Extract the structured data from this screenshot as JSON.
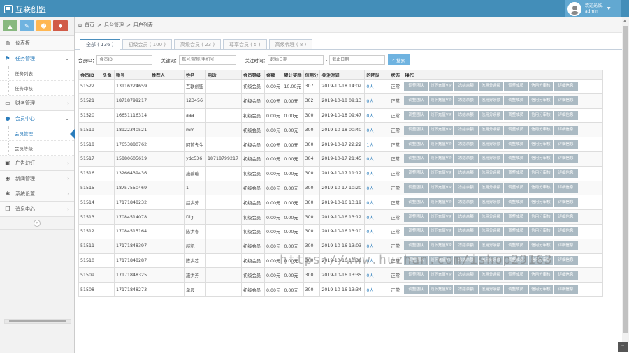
{
  "app": {
    "brand": "互联创盟"
  },
  "user": {
    "greeting": "欢迎光临,",
    "name": "admin"
  },
  "shortcuts": [
    {
      "icon": "chart-icon",
      "glyph": "▲",
      "color": "#87b87f"
    },
    {
      "icon": "pencil-icon",
      "glyph": "✎",
      "color": "#6fb3e0"
    },
    {
      "icon": "users-icon",
      "glyph": "☻",
      "color": "#ffb752"
    },
    {
      "icon": "bell-icon",
      "glyph": "♦",
      "color": "#d15b47"
    }
  ],
  "sidebar": {
    "items": [
      {
        "label": "仪表板",
        "icon": "dashboard-icon",
        "glyph": "◍"
      },
      {
        "label": "任务管理",
        "icon": "flag-icon",
        "glyph": "⚑",
        "open": true,
        "children": [
          "任务列表",
          "任务审核"
        ]
      },
      {
        "label": "财务管理",
        "icon": "credit-card-icon",
        "glyph": "▭"
      },
      {
        "label": "会员中心",
        "icon": "user-icon",
        "glyph": "●",
        "open": true,
        "children": [
          "会员管理",
          "会员等级"
        ],
        "active_child": "会员管理"
      },
      {
        "label": "广告幻灯",
        "icon": "picture-icon",
        "glyph": "▣"
      },
      {
        "label": "新闻管理",
        "icon": "globe-icon",
        "glyph": "◉"
      },
      {
        "label": "系统设置",
        "icon": "gear-icon",
        "glyph": "✱"
      },
      {
        "label": "消息中心",
        "icon": "bookmark-icon",
        "glyph": "❐"
      }
    ]
  },
  "breadcrumb": [
    "首页",
    "后台管理",
    "用户列表"
  ],
  "tabs": [
    "全部 ( 136 )",
    "初级会员 ( 100 )",
    "高级会员 ( 23 )",
    "尊享会员 ( 5 )",
    "高级代理 ( 8 )"
  ],
  "filters": {
    "id_label": "会员ID：",
    "id_placeholder": "会员ID",
    "keyword_label": "关键词：",
    "keyword_placeholder": "账号/昵称/手机号",
    "time_label": "关注时间：",
    "start_placeholder": "起始日期",
    "dash": "-",
    "end_placeholder": "截止日期",
    "search_label": "搜索"
  },
  "table": {
    "headers": [
      "会员ID",
      "头像",
      "账号",
      "推荐人",
      "姓名",
      "电话",
      "会员等级",
      "余额",
      "累计奖励",
      "信用分",
      "关注时间",
      "的团队",
      "状态",
      "操作"
    ],
    "actions": [
      "调整团队",
      "线下充值VIP",
      "冻结余额",
      "信用分余额",
      "调整成员",
      "信用分审核",
      "详细信息"
    ],
    "rows": [
      [
        "51522",
        "",
        "13116224659",
        "",
        "互联创盟",
        "",
        "初级会员",
        "0.00元",
        "10.00元",
        "307",
        "2019-10-18 14:02",
        "0人",
        "正常"
      ],
      [
        "51521",
        "",
        "18718799217",
        "",
        "123456",
        "",
        "初级会员",
        "0.00元",
        "0.00元",
        "302",
        "2019-10-18 09:13",
        "0人",
        "正常"
      ],
      [
        "51520",
        "",
        "16651116314",
        "",
        "aaa",
        "",
        "初级会员",
        "0.00元",
        "0.00元",
        "300",
        "2019-10-18 09:47",
        "0人",
        "正常"
      ],
      [
        "51519",
        "",
        "18922340521",
        "",
        "mm",
        "",
        "初级会员",
        "0.00元",
        "0.00元",
        "300",
        "2019-10-18 00:40",
        "0人",
        "正常"
      ],
      [
        "51518",
        "",
        "17653880762",
        "",
        "阿蓝先生",
        "",
        "初级会员",
        "0.00元",
        "0.00元",
        "300",
        "2019-10-17 22:22",
        "1人",
        "正常"
      ],
      [
        "51517",
        "",
        "15880605619",
        "",
        "ydc536",
        "18718799217",
        "初级会员",
        "0.00元",
        "0.00元",
        "304",
        "2019-10-17 21:45",
        "0人",
        "正常"
      ],
      [
        "51516",
        "",
        "13266439436",
        "",
        "施瑜瑜",
        "",
        "初级会员",
        "0.00元",
        "0.00元",
        "300",
        "2019-10-17 11:12",
        "0人",
        "正常"
      ],
      [
        "51515",
        "",
        "18757550469",
        "",
        "1",
        "",
        "初级会员",
        "0.00元",
        "0.00元",
        "300",
        "2019-10-17 10:20",
        "0人",
        "正常"
      ],
      [
        "51514",
        "",
        "17171848232",
        "",
        "赵洪芳",
        "",
        "初级会员",
        "0.00元",
        "0.00元",
        "300",
        "2019-10-16 13:19",
        "0人",
        "正常"
      ],
      [
        "51513",
        "",
        "17084514078",
        "",
        "Dig",
        "",
        "初级会员",
        "0.00元",
        "0.00元",
        "300",
        "2019-10-16 13:12",
        "0人",
        "正常"
      ],
      [
        "51512",
        "",
        "17084515164",
        "",
        "陈洪春",
        "",
        "初级会员",
        "0.00元",
        "0.00元",
        "300",
        "2019-10-16 13:10",
        "0人",
        "正常"
      ],
      [
        "51511",
        "",
        "17171848397",
        "",
        "赵凯",
        "",
        "初级会员",
        "0.00元",
        "0.00元",
        "300",
        "2019-10-16 13:03",
        "0人",
        "正常"
      ],
      [
        "51510",
        "",
        "17171848287",
        "",
        "陈洪芯",
        "",
        "初级会员",
        "0.00元",
        "0.00元",
        "300",
        "2019-10-16 13:36",
        "0人",
        "正常"
      ],
      [
        "51509",
        "",
        "17171848325",
        "",
        "施洪芳",
        "",
        "初级会员",
        "0.00元",
        "0.00元",
        "300",
        "2019-10-16 13:35",
        "0人",
        "正常"
      ],
      [
        "51508",
        "",
        "17171848273",
        "",
        "单辰",
        "",
        "初级会员",
        "0.00元",
        "0.00元",
        "300",
        "2019-10-16 13:34",
        "0人",
        "正常"
      ]
    ]
  },
  "watermark": "https://www.huzhan.com/ishop29163"
}
